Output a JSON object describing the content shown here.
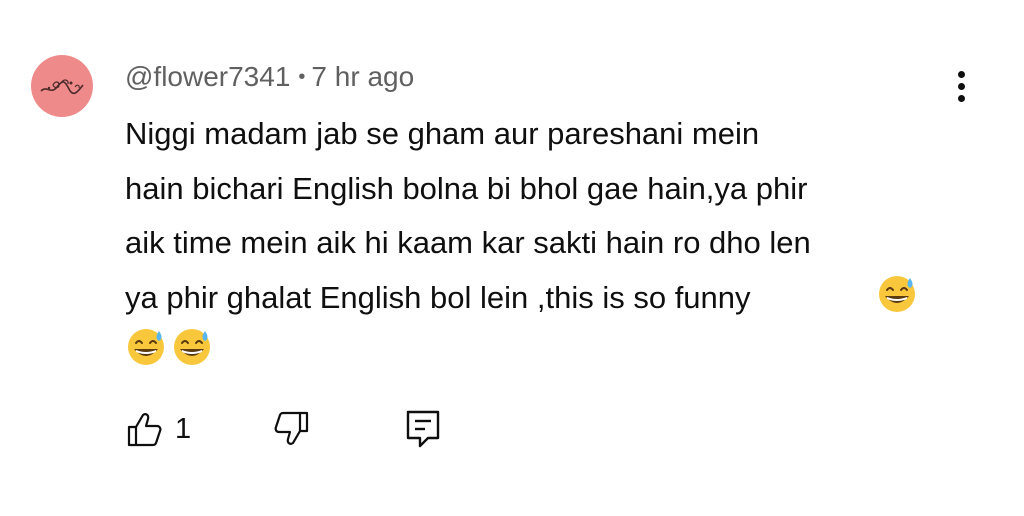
{
  "comment": {
    "author": "@flower7341",
    "separator": "•",
    "timestamp": "7 hr ago",
    "text": "Niggi madam jab se gham aur pareshani mein\nhain bichari English bolna bi bhol gae hain,ya phir\naik time mein aik hi kaam kar sakti hain ro dho len\nya phir ghalat English bol lein ,this is so funny",
    "emojis": [
      "grinning-sweat-emoji",
      "grinning-sweat-emoji",
      "grinning-sweat-emoji"
    ],
    "like_count": "1"
  },
  "colors": {
    "avatar_bg": "#ee8a8a",
    "meta_text": "#606060",
    "primary_text": "#0f0f0f",
    "emoji_face": "#f9c73b"
  },
  "icons": {
    "more": "more-vertical-icon",
    "like": "thumbs-up-icon",
    "dislike": "thumbs-down-icon",
    "reply": "reply-icon"
  }
}
